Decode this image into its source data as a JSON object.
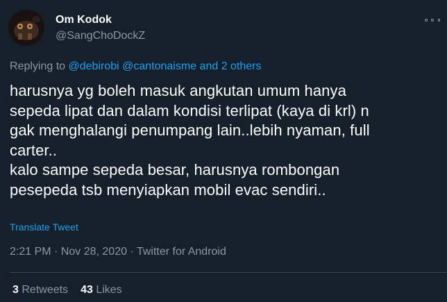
{
  "user": {
    "display_name": "Om Kodok",
    "handle": "@SangChoDockZ"
  },
  "reply": {
    "prefix": "Replying to",
    "mention1": "@debirobi",
    "mention2": "@cantonaisme",
    "and_others": "and 2 others"
  },
  "tweet": {
    "lines": [
      "harusnya yg boleh masuk angkutan umum hanya",
      "sepeda lipat dan dalam kondisi terlipat (kaya di krl) n",
      "gak menghalangi penumpang lain..lebih nyaman, full",
      "carter..",
      "kalo sampe sepeda besar, harusnya rombongan",
      "pesepeda tsb menyiapkan mobil evac sendiri.."
    ],
    "translate_label": "Translate Tweet"
  },
  "meta": {
    "time": "2:21 PM",
    "date": "Nov 28, 2020",
    "source": "Twitter for Android",
    "separator": " · "
  },
  "stats": {
    "retweets_count": "3",
    "retweets_label": "Retweets",
    "likes_count": "43",
    "likes_label": "Likes"
  },
  "colors": {
    "background": "#15202b",
    "text": "#ffffff",
    "muted": "#8899a6",
    "accent": "#1da1f2"
  }
}
